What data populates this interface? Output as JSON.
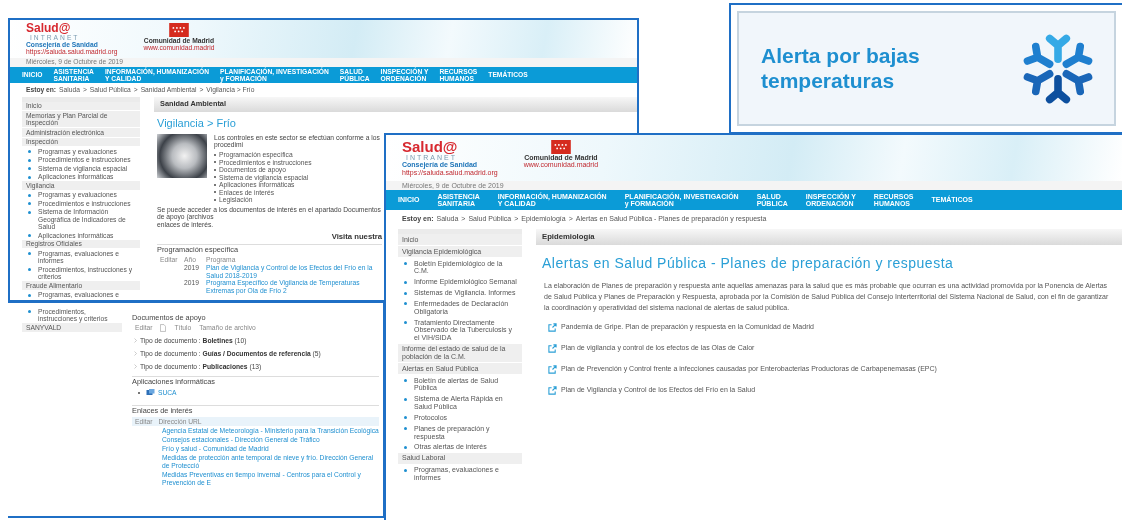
{
  "vigilancia_page": {
    "header": {
      "brand": "Salud@",
      "brand_sub": "INTRANET",
      "org": "Consejería de Sanidad",
      "org_url": "https://saluda.salud.madrid.org",
      "region": "Comunidad de Madrid",
      "region_url": "www.comunidad.madrid",
      "date": "Miércoles, 9 de Octubre de 2019"
    },
    "nav": [
      {
        "label": "INICIO"
      },
      {
        "label": "ASISTENCIA\nSANITARIA"
      },
      {
        "label": "INFORMACIÓN, HUMANIZACIÓN\nY CALIDAD"
      },
      {
        "label": "PLANIFICACIÓN, INVESTIGACIÓN\ny FORMACIÓN"
      },
      {
        "label": "SALUD\nPÚBLICA"
      },
      {
        "label": "INSPECCIÓN Y\nORDENACIÓN"
      },
      {
        "label": "RECURSOS\nHUMANOS"
      },
      {
        "label": "TEMÁTICOS"
      }
    ],
    "breadcrumb": {
      "prefix": "Estoy en:",
      "links": [
        "Saluda",
        "Salud Pública",
        "Sanidad Ambiental"
      ],
      "separator": ">",
      "current": "Vigilancia > Frío"
    },
    "sidebar": [
      {
        "kind": "heading",
        "label": "Inicio"
      },
      {
        "kind": "heading",
        "label": "Memorias y Plan Parcial de Inspección"
      },
      {
        "kind": "heading",
        "label": "Administración electrónica"
      },
      {
        "kind": "heading",
        "label": "Inspección"
      },
      {
        "kind": "link",
        "label": "Programas y evaluaciones"
      },
      {
        "kind": "link",
        "label": "Procedimientos e instrucciones"
      },
      {
        "kind": "link",
        "label": "Sistema de vigilancia espacial"
      },
      {
        "kind": "link",
        "label": "Aplicaciones informáticas"
      },
      {
        "kind": "heading",
        "label": "Vigilancia"
      },
      {
        "kind": "link",
        "label": "Programas y evaluaciones"
      },
      {
        "kind": "link",
        "label": "Procedimientos e instrucciones"
      },
      {
        "kind": "link",
        "label": "Sistema de Información Geográfica de Indicadores de Salud"
      },
      {
        "kind": "link",
        "label": "Aplicaciones informáticas"
      },
      {
        "kind": "heading",
        "label": "Registros Oficiales"
      },
      {
        "kind": "link",
        "label": "Programas, evaluaciones e informes"
      },
      {
        "kind": "link",
        "label": "Procedimientos, instrucciones y criterios"
      },
      {
        "kind": "heading",
        "label": "Fraude Alimentario"
      },
      {
        "kind": "link",
        "label": "Programas, evaluaciones e"
      }
    ],
    "section": "Sanidad Ambiental",
    "title": "Vigilancia > Frío",
    "intro": "Los controles en este sector se efectúan conforme a los procedimi",
    "topics": [
      "Programación específica",
      "Procedimientos e instrucciones",
      "Documentos de apoyo",
      "Sistema de vigilancia espacial",
      "Aplicaciones informáticas",
      "Enlaces de interés",
      "Legislación"
    ],
    "note_lines": [
      "Se puede acceder a los documentos de interés en el apartado Documentos de apoyo (archivos",
      "enlaces de interés."
    ],
    "visit": "Visita nuestra",
    "programming": {
      "heading": "Programación específica",
      "columns": [
        "Editar",
        "Año",
        "Programa"
      ],
      "rows": [
        {
          "year": "2019",
          "program": "Plan de Vigilancia y Control de los Efectos del Frío en la Salud 2018-2019"
        },
        {
          "year": "2019",
          "program": "Programa Específico de Vigilancia de Temperaturas Extremas por Ola de Frío 2"
        }
      ]
    }
  },
  "vigilancia_page_continued": {
    "sidebar": [
      {
        "kind": "link",
        "label": "Procedimientos, instrucciones y criterios"
      },
      {
        "kind": "heading",
        "label": "SANYVALD"
      }
    ],
    "documents": {
      "heading": "Documentos de apoyo",
      "columns": [
        "Editar",
        "Título",
        "Tamaño de archivo"
      ],
      "groups": [
        "Tipo de documento : **Boletines** (10)",
        "Tipo de documento : **Guías / Documentos de referencia** (5)",
        "Tipo de documento : **Publicaciones** (13)"
      ]
    },
    "applications": {
      "heading": "Aplicaciones informáticas",
      "items": [
        "SUCA"
      ]
    },
    "links": {
      "heading": "Enlaces de interés",
      "columns": [
        "Editar",
        "Dirección URL"
      ],
      "items": [
        "Agencia Estatal de Meteorología - Ministerio para la Transición Ecológica",
        "Consejos estacionales - Dirección General de Tráfico",
        "Frío y salud - Comunidad de Madrid",
        "Medidas de protección ante temporal de nieve y frío. Dirección General de Protecció",
        "Medidas Preventivas en tiempo invernal - Centros para el Control y Prevención de E"
      ]
    }
  },
  "epidemiologia_page": {
    "header": {
      "brand": "Salud@",
      "brand_sub": "INTRANET",
      "org": "Consejería de Sanidad",
      "org_url": "https://saluda.salud.madrid.org",
      "region": "Comunidad de Madrid",
      "region_url": "www.comunidad.madrid",
      "date": "Miércoles, 9 de Octubre de 2019"
    },
    "nav": [
      {
        "label": "INICIO"
      },
      {
        "label": "ASISTENCIA\nSANITARIA"
      },
      {
        "label": "INFORMACIÓN, HUMANIZACIÓN\nY CALIDAD"
      },
      {
        "label": "PLANIFICACIÓN, INVESTIGACIÓN\ny FORMACIÓN"
      },
      {
        "label": "SALUD\nPÚBLICA"
      },
      {
        "label": "INSPECCIÓN Y\nORDENACIÓN"
      },
      {
        "label": "RECURSOS\nHUMANOS"
      },
      {
        "label": "TEMÁTICOS"
      }
    ],
    "breadcrumb": {
      "prefix": "Estoy en:",
      "links": [
        "Saluda",
        "Salud Pública",
        "Epidemiología"
      ],
      "separator": ">",
      "current": "Alertas en Salud Pública - Planes de preparación y respuesta"
    },
    "sidebar": [
      {
        "kind": "heading",
        "label": "Inicio"
      },
      {
        "kind": "heading",
        "label": "Vigilancia Epidemiológica"
      },
      {
        "kind": "link",
        "label": "Boletín Epidemiológico de la C.M."
      },
      {
        "kind": "link",
        "label": "Informe Epidemiológico Semanal"
      },
      {
        "kind": "link",
        "label": "Sistemas de Vigilancia. Informes"
      },
      {
        "kind": "link",
        "label": "Enfermedades de Declaración Obligatoria"
      },
      {
        "kind": "link",
        "label": "Tratamiento Directamente Observado de la Tuberculosis y el VIH/SIDA"
      },
      {
        "kind": "heading",
        "label": "Informe del estado de salud de la población de la C.M."
      },
      {
        "kind": "heading",
        "label": "Alertas en Salud Pública"
      },
      {
        "kind": "link",
        "label": "Boletín de alertas de Salud Pública"
      },
      {
        "kind": "link",
        "label": "Sistema de Alerta Rápida en Salud Pública"
      },
      {
        "kind": "link",
        "label": "Protocolos"
      },
      {
        "kind": "link",
        "label": "Planes de preparación y respuesta"
      },
      {
        "kind": "link",
        "label": "Otras alertas de interés"
      },
      {
        "kind": "heading",
        "label": "Salud Laboral"
      },
      {
        "kind": "link",
        "label": "Programas, evaluaciones e informes"
      }
    ],
    "section": "Epidemiología",
    "title": "Alertas en Salud Pública - Planes de preparación y respuesta",
    "paragraph": "La elaboración de Planes de preparación y respuesta ante aquellas amenazas para la salud que es más probable que ocurran es una actividad promovida por la Ponencia de Alertas de Salud Pública y Planes de Preparación y Respuesta, aprobada por la Comisión de Salud Pública del Consejo Interterritorial del Sistema Nacional de Salud, con el fin de garantizar la coordinación y operatividad del sistema nacional de alertas de salud pública.",
    "links": [
      "Pandemia de Gripe. Plan de preparación y respuesta en la Comunidad de Madrid",
      "Plan de vigilancia y control de los efectos de las Olas de Calor",
      "Plan de Prevención y Control frente a infecciones causadas por Enterobacterias Productoras de Carbapenemasas (EPC)",
      "Plan de Vigilancia y Control de los Efectos del Frío en la Salud"
    ]
  },
  "alert_banner": {
    "title": "Alerta por bajas temperaturas"
  }
}
